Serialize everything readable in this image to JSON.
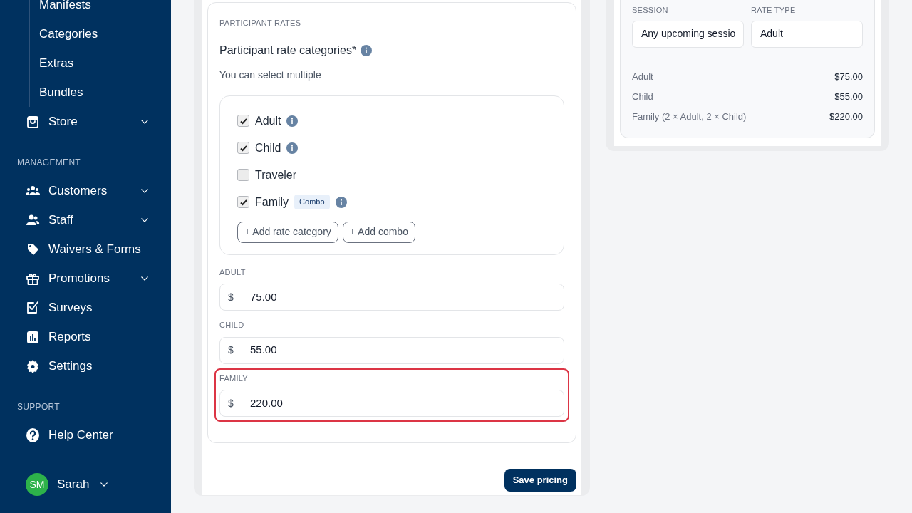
{
  "sidebar": {
    "sub_items": [
      "Manifests",
      "Categories",
      "Extras",
      "Bundles"
    ],
    "groups": [
      {
        "items": [
          {
            "label": "Store",
            "expandable": true
          }
        ]
      },
      {
        "heading": "MANAGEMENT",
        "items": [
          {
            "label": "Customers",
            "expandable": true
          },
          {
            "label": "Staff",
            "expandable": true
          },
          {
            "label": "Waivers & Forms",
            "expandable": false
          },
          {
            "label": "Promotions",
            "expandable": true
          },
          {
            "label": "Surveys",
            "expandable": false
          },
          {
            "label": "Reports",
            "expandable": false
          },
          {
            "label": "Settings",
            "expandable": false
          }
        ]
      },
      {
        "heading": "SUPPORT",
        "items": [
          {
            "label": "Help Center",
            "expandable": false
          }
        ]
      }
    ],
    "user": {
      "initials": "SM",
      "name": "Sarah"
    }
  },
  "rates": {
    "section_title": "PARTICIPANT RATES",
    "question": "Participant rate categories*",
    "hint": "You can select multiple",
    "categories": [
      {
        "label": "Adult",
        "checked": true,
        "info": true
      },
      {
        "label": "Child",
        "checked": true,
        "info": true
      },
      {
        "label": "Traveler",
        "checked": false,
        "info": false
      },
      {
        "label": "Family",
        "checked": true,
        "badge": "Combo",
        "info": true
      }
    ],
    "add_buttons": [
      "+ Add rate category",
      "+ Add combo"
    ],
    "price_fields": [
      {
        "label": "ADULT",
        "prefix": "$",
        "value": "75.00",
        "highlighted": false
      },
      {
        "label": "CHILD",
        "prefix": "$",
        "value": "55.00",
        "highlighted": false
      },
      {
        "label": "FAMILY",
        "prefix": "$",
        "value": "220.00",
        "highlighted": true
      }
    ],
    "save_button": "Save pricing"
  },
  "preview": {
    "session_label": "SESSION",
    "session_value": "Any upcoming sessio",
    "rate_type_label": "RATE TYPE",
    "rate_type_value": "Adult",
    "lines": [
      {
        "name": "Adult",
        "price": "$75.00"
      },
      {
        "name": "Child",
        "price": "$55.00"
      },
      {
        "name": "Family (2 × Adult, 2 × Child)",
        "price": "$220.00"
      }
    ]
  }
}
